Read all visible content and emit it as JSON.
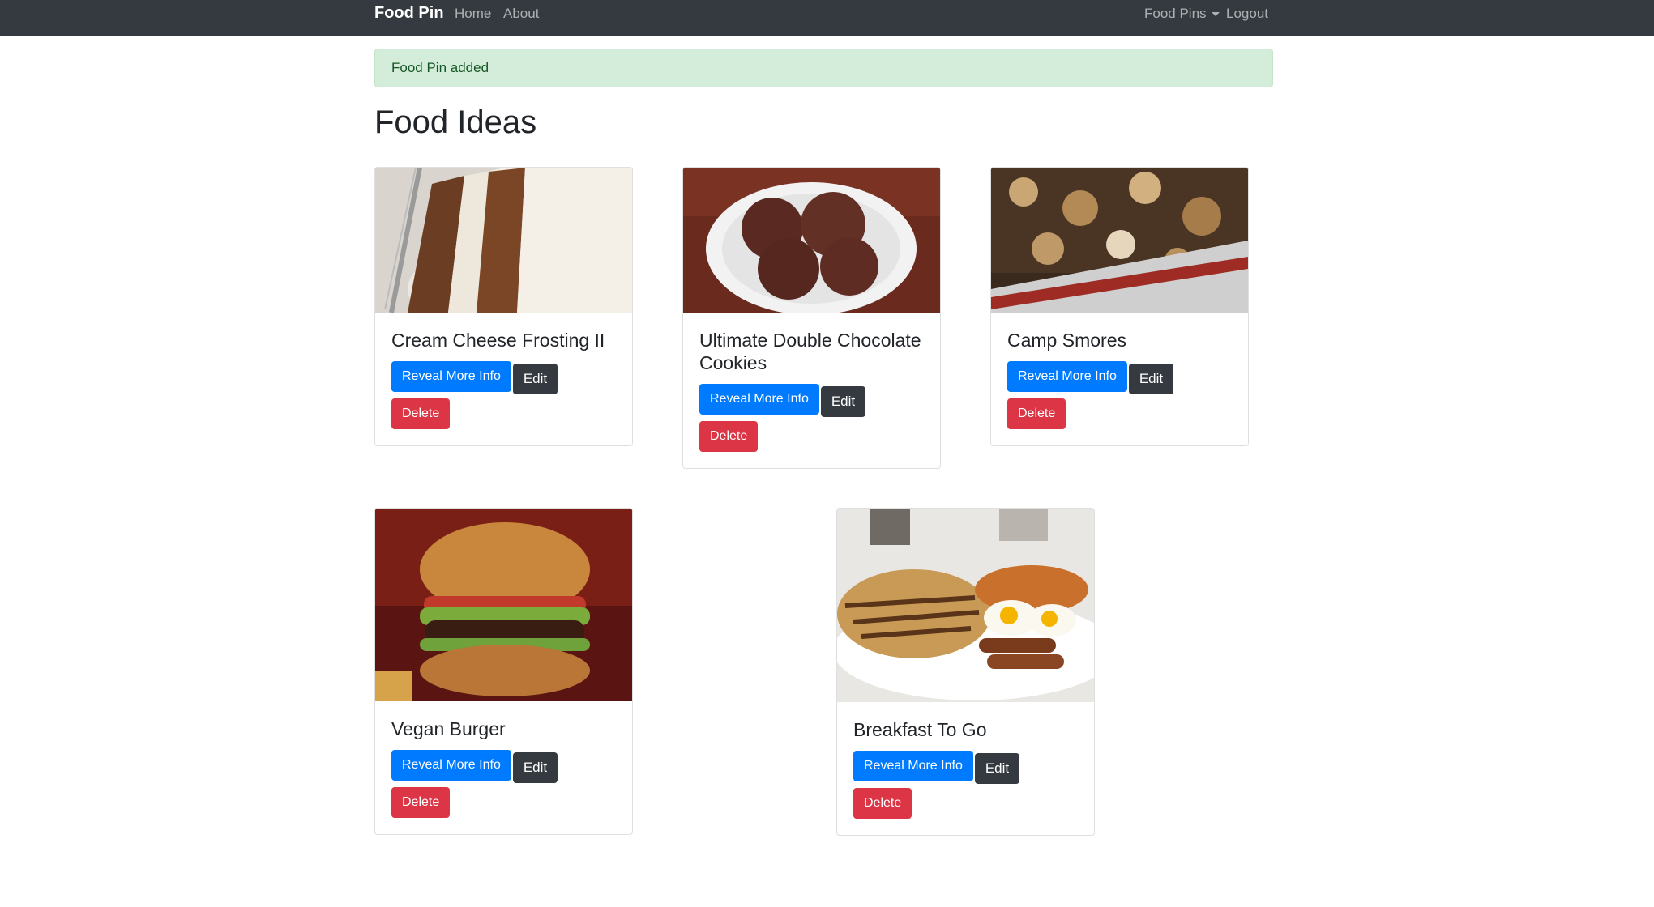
{
  "navbar": {
    "brand": "Food Pin",
    "links": [
      "Home",
      "About"
    ],
    "dropdown_label": "Food Pins",
    "logout": "Logout"
  },
  "alert": "Food Pin added",
  "page_title": "Food Ideas",
  "cards": [
    {
      "title": "Cream Cheese Frosting II",
      "image": "carrot-cake-slice",
      "reveal": "Reveal More Info",
      "edit": "Edit",
      "delete": "Delete"
    },
    {
      "title": "Ultimate Double Chocolate Cookies",
      "image": "chocolate-cookies-plate",
      "reveal": "Reveal More Info",
      "edit": "Edit",
      "delete": "Delete"
    },
    {
      "title": "Camp Smores",
      "image": "smores-bake",
      "reveal": "Reveal More Info",
      "edit": "Edit",
      "delete": "Delete"
    },
    {
      "title": "Vegan Burger",
      "image": "burger",
      "reveal": "Reveal More Info",
      "edit": "Edit",
      "delete": "Delete"
    },
    {
      "title": "Breakfast To Go",
      "image": "pancakes-eggs-sausage",
      "reveal": "Reveal More Info",
      "edit": "Edit",
      "delete": "Delete"
    }
  ],
  "colors": {
    "navbar": "#343a40",
    "primary": "#007bff",
    "dark": "#343a40",
    "danger": "#dc3545",
    "alert_bg": "#d4edda",
    "alert_text": "#155724"
  }
}
